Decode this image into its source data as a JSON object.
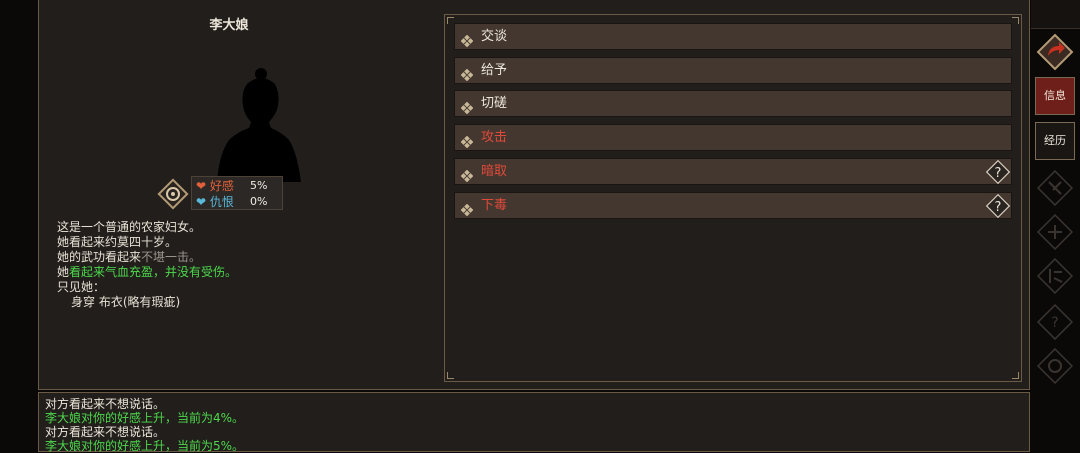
{
  "npc": {
    "name": "李大娘",
    "affection_label": "好感",
    "affection_value": "5%",
    "hatred_label": "仇恨",
    "hatred_value": "0%"
  },
  "description": [
    {
      "text": "这是一个普通的农家妇女。",
      "color": "#e8e2d6"
    },
    {
      "text": "她看起来约莫四十岁。",
      "color": "#e8e2d6"
    }
  ],
  "martial": {
    "prefix": "她的武功看起来",
    "value": "不堪一击",
    "suffix": "。",
    "value_color": "#9a948c"
  },
  "health": {
    "prefix": "她",
    "value": "看起来气血充盈，并没有受伤。",
    "value_color": "#4cd84c"
  },
  "appearance": {
    "heading": "只见她：",
    "wear_label": "身穿",
    "wear_item": "布衣",
    "wear_note": "(略有瑕疵)"
  },
  "actions": [
    {
      "label": "交谈",
      "color": "#ece6da",
      "help": false
    },
    {
      "label": "给予",
      "color": "#ece6da",
      "help": false
    },
    {
      "label": "切磋",
      "color": "#ece6da",
      "help": false
    },
    {
      "label": "攻击",
      "color": "#e04a3a",
      "help": false
    },
    {
      "label": "暗取",
      "color": "#e04a3a",
      "help": true
    },
    {
      "label": "下毒",
      "color": "#e04a3a",
      "help": true
    }
  ],
  "side": {
    "info_label": "信息",
    "history_label": "经历"
  },
  "log": [
    {
      "text": "对方看起来不想说话。",
      "color": "#ece6da"
    },
    {
      "text": "李大娘对你的好感上升，当前为4%。",
      "color": "#4cd84c"
    },
    {
      "text": "对方看起来不想说话。",
      "color": "#ece6da"
    },
    {
      "text": "李大娘对你的好感上升，当前为5%。",
      "color": "#4cd84c"
    }
  ],
  "colors": {
    "affection": "#e0603a",
    "hatred": "#5ab8d8",
    "accent": "#8a2a22"
  }
}
